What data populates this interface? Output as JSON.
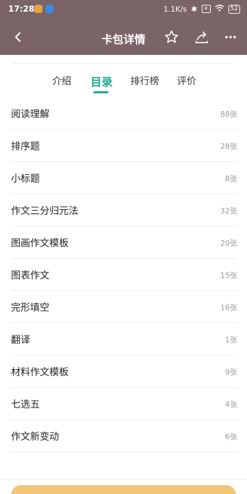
{
  "status_bar": {
    "time": "17:28",
    "network_speed": "1.1K/s",
    "battery": "52",
    "icons": [
      "alarm-icon",
      "cloud-icon",
      "bluetooth-icon",
      "sim-x-icon",
      "wifi-icon",
      "battery-icon"
    ]
  },
  "nav": {
    "title": "卡包详情",
    "back_icon": "back-arrow-icon",
    "star_icon": "star-icon",
    "share_icon": "share-icon",
    "more_icon": "more-dots-icon"
  },
  "tabs": [
    {
      "label": "介绍"
    },
    {
      "label": "目录"
    },
    {
      "label": "排行榜"
    },
    {
      "label": "评价"
    }
  ],
  "active_tab": "目录",
  "list": [
    {
      "name": "阅读理解",
      "count": "88张"
    },
    {
      "name": "排序题",
      "count": "28张"
    },
    {
      "name": "小标题",
      "count": "8张"
    },
    {
      "name": "作文三分归元法",
      "count": "32张"
    },
    {
      "name": "图画作文模板",
      "count": "20张"
    },
    {
      "name": "图表作文",
      "count": "15张"
    },
    {
      "name": "完形填空",
      "count": "16张"
    },
    {
      "name": "翻译",
      "count": "1张"
    },
    {
      "name": "材料作文模板",
      "count": "9张"
    },
    {
      "name": "七选五",
      "count": "4张"
    },
    {
      "name": "作文新变动",
      "count": "6张"
    }
  ],
  "colors": {
    "header": "#7a6468",
    "accent": "#1bab8e",
    "bottom_button": "#f1c575"
  }
}
